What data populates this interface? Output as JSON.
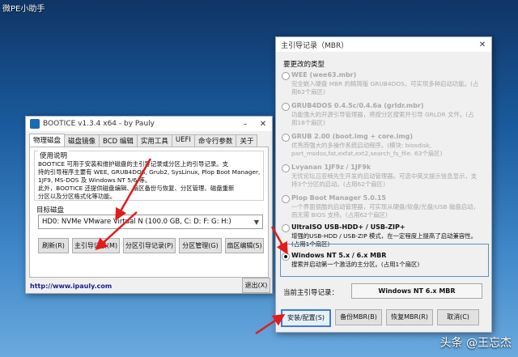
{
  "desktop": {
    "title": "微PE小助手",
    "watermark": "头条 @王忘杰"
  },
  "bootice": {
    "title": "BOOTICE v1.3.4 x64 - by Pauly",
    "tabs": [
      "物理磁盘",
      "磁盘镜像",
      "BCD 编辑",
      "实用工具",
      "UEFI",
      "命令行参数",
      "关于"
    ],
    "active_tab": 0,
    "desc_title": "使用说明",
    "desc_lines": [
      "BOOTICE 可用于安装和维护磁盘的主引导记录或分区上的引导记录。支",
      "持的引导程序主要有 WEE, GRUB4DOS, Grub2, SysLinux, Plop Boot Manager,",
      "1JF9, MS-DOS 及 Windows NT 5/6 等。",
      "此外，BOOTICE 还提供磁盘编辑、扇区备份与恢复、分区管理、磁盘重新",
      "分区以及分区格式化等功能。"
    ],
    "target_label": "目标磁盘",
    "disk_selected": "HD0: NVMe VMware Virtual N (100.0 GB, C: D: F: G: H:)",
    "buttons": [
      "刷新(R)",
      "主引导记录(M)",
      "分区引导记录(P)",
      "分区管理(G)",
      "扇区编辑(S)"
    ],
    "link": "http://www.ipauly.com",
    "exit": "退出(X)"
  },
  "mbr_dialog": {
    "title": "主引导记录（MBR）",
    "types_label": "要更改的类型",
    "options": [
      {
        "title": "WEE (wee63.mbr)",
        "desc": "完全嵌入硬盘 MBR 的精简版 GRUB4DOS，可实现多种启动功能。(占用62个扇区)",
        "enabled": false,
        "checked": false
      },
      {
        "title": "GRUB4DOS 0.4.5c/0.4.6a (grldr.mbr)",
        "desc": "功能强大的开源引导管理器，将按分区搜索并引导 GRLDR 文件。(占用16个扇区)",
        "enabled": false,
        "checked": false
      },
      {
        "title": "GRUB 2.00 (boot.img + core.img)",
        "desc": "优秀而强大的多操作系统启动程序。(模块: biosdisk, part_msdos,fat,exfat,ext2,search_fs_file. 63个扇区)",
        "enabled": false,
        "checked": false
      },
      {
        "title": "Lvyanan 1JF9z / 1JF9k",
        "desc": "无忧论坛吕亚楠先生开发的启动管理器。可选中英文提示信息显示，支持3个分区的启动。(占用62个扇区)",
        "enabled": false,
        "checked": false
      },
      {
        "title": "Plop Boot Manager 5.0.15",
        "desc": "一个界面很酷的启动管理器，可实现从硬盘/软盘/光盘/USB 磁盘启动，而无需 BIOS 支持。(占用62个扇区)",
        "enabled": false,
        "checked": false
      },
      {
        "title": "UltraISO USB-HDD+ / USB-ZIP+",
        "desc": "增强的USB-HDD / USB-ZIP 模式，在一定程度上提高了启动兼容性。(占用1个扇区)",
        "enabled": true,
        "checked": false
      },
      {
        "title": "Windows NT 5.x / 6.x MBR",
        "desc": "搜索并启动第一个激活的主分区。(占用1个扇区)",
        "enabled": true,
        "checked": true
      }
    ],
    "current_label": "当前主引导记录：",
    "current_value": "Windows NT 6.x MBR",
    "buttons": [
      "安装/配置(S)",
      "备份MBR(B)",
      "恢复MBR(R)",
      "取消(C)"
    ]
  },
  "colors": {
    "accent": "#3f7fd1",
    "arrow": "#e21b1b",
    "desktop": "#1a5a9c"
  }
}
